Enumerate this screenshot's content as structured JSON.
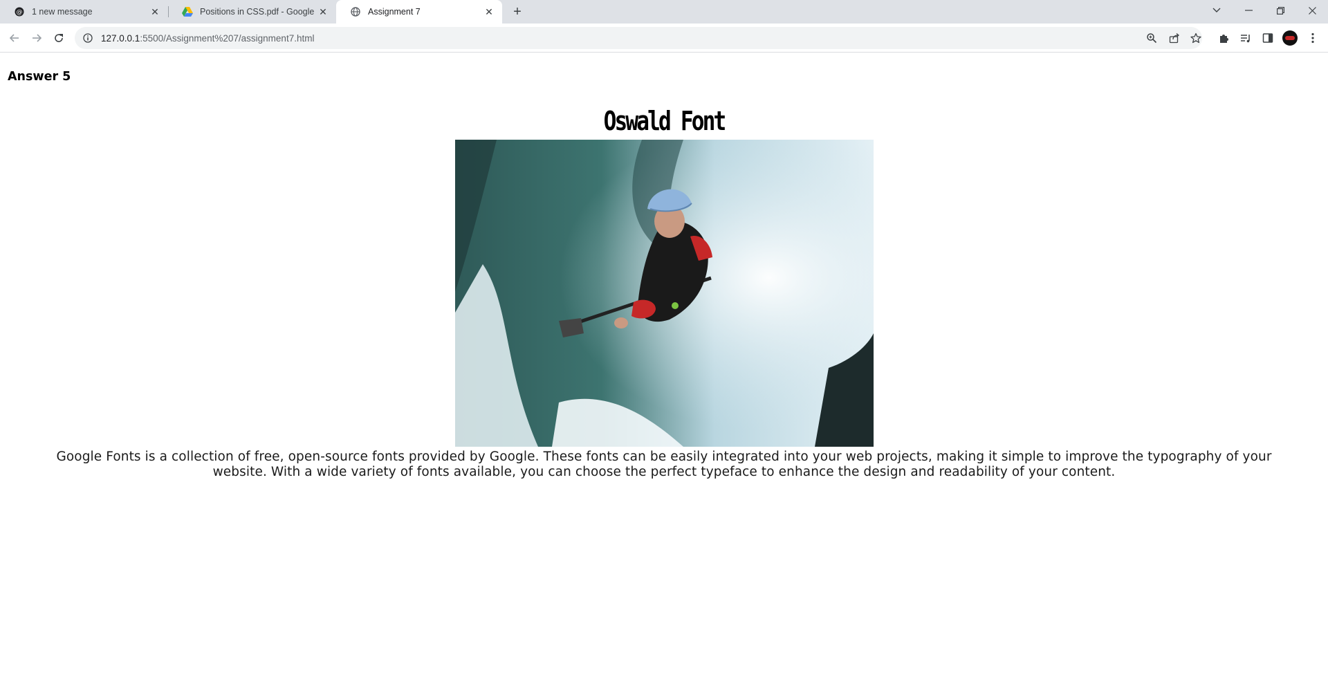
{
  "browser": {
    "tabs": [
      {
        "title": "1 new message",
        "icon": "threads-icon",
        "active": false
      },
      {
        "title": "Positions in CSS.pdf - Google Dr",
        "icon": "google-drive-icon",
        "active": false
      },
      {
        "title": "Assignment 7",
        "icon": "globe-icon",
        "active": true
      }
    ],
    "new_tab_label": "+",
    "address": {
      "host": "127.0.0.1",
      "path": ":5500/Assignment%207/assignment7.html"
    }
  },
  "page": {
    "answer_label": "Answer 5",
    "heading": "Oswald Font",
    "image": {
      "subject": "kayaker-in-whitewater",
      "accent": "#3a6f6d"
    },
    "paragraph": "Google Fonts is a collection of free, open-source fonts provided by Google. These fonts can be easily integrated into your web projects, making it simple to improve the typography of your website. With a wide variety of fonts available, you can choose the perfect typeface to enhance the design and readability of your content."
  },
  "colors": {
    "tabstrip_bg": "#dee1e6",
    "omnibox_bg": "#f1f3f4",
    "page_bg": "#ffffff"
  }
}
